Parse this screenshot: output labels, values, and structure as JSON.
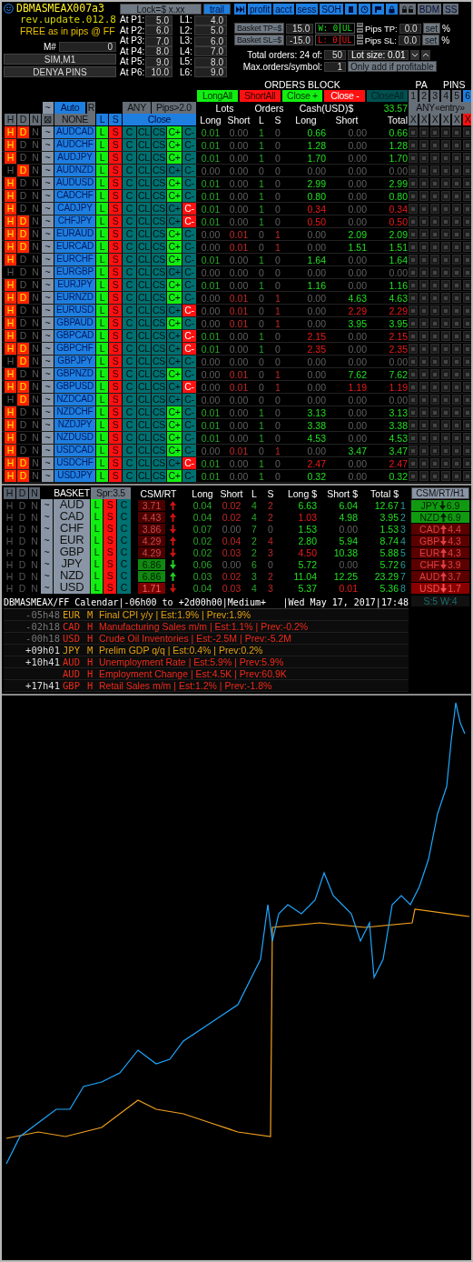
{
  "header": {
    "title": "DBMASMEAX007a3",
    "revision": "rev.update.012.8",
    "tagline": "FREE as in pips @ FF",
    "magic_label": "M#",
    "magic_value": "0",
    "buttons": [
      "SIM,M1",
      "DENYA PINS"
    ]
  },
  "lock": {
    "label": "Lock=$ x.xx",
    "trail": {
      "label": "trail",
      "on": true
    }
  },
  "levels": [
    {
      "p_label": "At P1:",
      "p_value": "5.0",
      "l_label": "L1:",
      "l_value": "4.0"
    },
    {
      "p_label": "At P2:",
      "p_value": "6.0",
      "l_label": "L2:",
      "l_value": "5.0"
    },
    {
      "p_label": "At P3:",
      "p_value": "7.0",
      "l_label": "L3:",
      "l_value": "6.0"
    },
    {
      "p_label": "At P4:",
      "p_value": "8.0",
      "l_label": "L4:",
      "l_value": "7.0"
    },
    {
      "p_label": "At P5:",
      "p_value": "9.0",
      "l_label": "L5:",
      "l_value": "8.0"
    },
    {
      "p_label": "At P6:",
      "p_value": "10.0",
      "l_label": "L6:",
      "l_value": "9.0"
    }
  ],
  "toolbar": [
    {
      "kind": "skip",
      "on": true
    },
    {
      "kind": "text",
      "label": "profit",
      "on": true
    },
    {
      "kind": "text",
      "label": "acct",
      "on": true
    },
    {
      "kind": "text",
      "label": "sess",
      "on": true
    },
    {
      "kind": "text",
      "label": "SOH",
      "on": true
    },
    {
      "kind": "clipboard",
      "on": true
    },
    {
      "kind": "clock",
      "on": true
    },
    {
      "kind": "flag",
      "on": true
    },
    {
      "kind": "lock",
      "on": true
    },
    {
      "kind": "locks",
      "on": false
    },
    {
      "kind": "text",
      "label": "BDM",
      "on": false
    },
    {
      "kind": "text",
      "label": "SS",
      "on": false
    }
  ],
  "basket_limits": [
    {
      "label": "Basket TP=$",
      "value": "15.0",
      "counter": "W: 0",
      "unit": "UL",
      "kind": "win",
      "pips_label": "Pips TP:",
      "pips_value": "0.0",
      "set": "set",
      "percent": "%"
    },
    {
      "label": "Basket SL=$",
      "value": "-15.0",
      "counter": "L: 0",
      "unit": "UL",
      "kind": "loss",
      "pips_label": "Pips SL:",
      "pips_value": "0.0",
      "set": "set",
      "percent": "%"
    }
  ],
  "orders_settings": {
    "total_label": "Total orders: 24 of:",
    "total_value": "50",
    "lot_size": "Lot size: 0.01",
    "max_label": "Max.orders/symbol:",
    "max_value": "1",
    "add_button": "Only add if profitable"
  },
  "orders_block": {
    "title": "ORDERS BLOCK",
    "pa": "PA",
    "pins_label": "PINS",
    "actions": [
      {
        "label": "LongAll",
        "kind": "buy"
      },
      {
        "label": "ShortAll",
        "kind": "sell"
      },
      {
        "label": "Close +",
        "kind": "buy"
      },
      {
        "label": "Close -",
        "kind": "sell"
      },
      {
        "label": "CloseAll",
        "kind": "all"
      }
    ],
    "pins": [
      {
        "label": "1",
        "selected": false
      },
      {
        "label": "2",
        "selected": false
      },
      {
        "label": "3",
        "selected": false
      },
      {
        "label": "4",
        "selected": false
      },
      {
        "label": "5",
        "selected": false
      },
      {
        "label": "6",
        "selected": true
      }
    ],
    "mode": "~",
    "auto": "Auto",
    "reset": "R",
    "any": "ANY",
    "pips_filter": "Pips>2.0",
    "lots": "Lots",
    "orders": "Orders",
    "cash": "Cash(USD)$",
    "cash_total": "33.57",
    "entry": "ANY«entry»",
    "filters": [
      "H",
      "D",
      "N",
      "⊠"
    ],
    "none": "NONE",
    "long": "L",
    "short": "S",
    "close": "Close",
    "columns": [
      "Long",
      "Short",
      "L",
      "S",
      "Long",
      "Short",
      "Total"
    ],
    "clear": [
      "X",
      "X",
      "X",
      "X",
      "X",
      "X"
    ]
  },
  "rows": [
    {
      "flags": [
        {
          "label": "H",
          "on": true
        },
        {
          "label": "D",
          "on": true
        },
        {
          "label": "N",
          "on": false
        }
      ],
      "mode": "~",
      "pair": "AUDCAD",
      "actions": [
        "L",
        "S",
        "C",
        "CL",
        "CS"
      ],
      "close_plus": {
        "label": "C+",
        "on": true
      },
      "close_minus": {
        "label": "C-",
        "on": false
      },
      "long_open": true,
      "short_open": false,
      "lots_long": "0.01",
      "lots_short": "0.00",
      "orders_long": "1",
      "orders_short": "0",
      "cash_long": "0.66",
      "cash_short": "0.00",
      "total": "0.66"
    },
    {
      "flags": [
        {
          "label": "H",
          "on": true
        },
        {
          "label": "D",
          "on": false
        },
        {
          "label": "N",
          "on": false
        }
      ],
      "mode": "~",
      "pair": "AUDCHF",
      "actions": [
        "L",
        "S",
        "C",
        "CL",
        "CS"
      ],
      "close_plus": {
        "label": "C+",
        "on": true
      },
      "close_minus": {
        "label": "C-",
        "on": false
      },
      "long_open": true,
      "short_open": false,
      "lots_long": "0.01",
      "lots_short": "0.00",
      "orders_long": "1",
      "orders_short": "0",
      "cash_long": "1.28",
      "cash_short": "0.00",
      "total": "1.28"
    },
    {
      "flags": [
        {
          "label": "H",
          "on": true
        },
        {
          "label": "D",
          "on": false
        },
        {
          "label": "N",
          "on": false
        }
      ],
      "mode": "~",
      "pair": "AUDJPY",
      "actions": [
        "L",
        "S",
        "C",
        "CL",
        "CS"
      ],
      "close_plus": {
        "label": "C+",
        "on": true
      },
      "close_minus": {
        "label": "C-",
        "on": false
      },
      "long_open": true,
      "short_open": false,
      "lots_long": "0.01",
      "lots_short": "0.00",
      "orders_long": "1",
      "orders_short": "0",
      "cash_long": "1.70",
      "cash_short": "0.00",
      "total": "1.70"
    },
    {
      "flags": [
        {
          "label": "H",
          "on": false
        },
        {
          "label": "D",
          "on": true
        },
        {
          "label": "N",
          "on": false
        }
      ],
      "mode": "~",
      "pair": "AUDNZD",
      "actions": [
        "L",
        "S",
        "C",
        "CL",
        "CS"
      ],
      "close_plus": {
        "label": "C+",
        "on": false
      },
      "close_minus": {
        "label": "C-",
        "on": false
      },
      "long_open": false,
      "short_open": false,
      "lots_long": "0.00",
      "lots_short": "0.00",
      "orders_long": "0",
      "orders_short": "0",
      "cash_long": "0.00",
      "cash_short": "0.00",
      "total": "0.00"
    },
    {
      "flags": [
        {
          "label": "H",
          "on": true
        },
        {
          "label": "D",
          "on": false
        },
        {
          "label": "N",
          "on": false
        }
      ],
      "mode": "~",
      "pair": "AUDUSD",
      "actions": [
        "L",
        "S",
        "C",
        "CL",
        "CS"
      ],
      "close_plus": {
        "label": "C+",
        "on": true
      },
      "close_minus": {
        "label": "C-",
        "on": false
      },
      "long_open": true,
      "short_open": false,
      "lots_long": "0.01",
      "lots_short": "0.00",
      "orders_long": "1",
      "orders_short": "0",
      "cash_long": "2.99",
      "cash_short": "0.00",
      "total": "2.99"
    },
    {
      "flags": [
        {
          "label": "H",
          "on": true
        },
        {
          "label": "D",
          "on": false
        },
        {
          "label": "N",
          "on": false
        }
      ],
      "mode": "~",
      "pair": "CADCHF",
      "actions": [
        "L",
        "S",
        "C",
        "CL",
        "CS"
      ],
      "close_plus": {
        "label": "C+",
        "on": true
      },
      "close_minus": {
        "label": "C-",
        "on": false
      },
      "long_open": true,
      "short_open": false,
      "lots_long": "0.01",
      "lots_short": "0.00",
      "orders_long": "1",
      "orders_short": "0",
      "cash_long": "0.80",
      "cash_short": "0.00",
      "total": "0.80"
    },
    {
      "flags": [
        {
          "label": "H",
          "on": true
        },
        {
          "label": "D",
          "on": false
        },
        {
          "label": "N",
          "on": false
        }
      ],
      "mode": "~",
      "pair": "CADJPY",
      "actions": [
        "L",
        "S",
        "C",
        "CL",
        "CS"
      ],
      "close_plus": {
        "label": "C+",
        "on": false
      },
      "close_minus": {
        "label": "C-",
        "on": true
      },
      "long_open": true,
      "short_open": false,
      "lots_long": "0.01",
      "lots_short": "0.00",
      "orders_long": "1",
      "orders_short": "0",
      "cash_long": "0.34",
      "cash_short": "0.00",
      "total": "0.34"
    },
    {
      "flags": [
        {
          "label": "H",
          "on": true
        },
        {
          "label": "D",
          "on": true
        },
        {
          "label": "N",
          "on": false
        }
      ],
      "mode": "~",
      "pair": "CHFJPY",
      "actions": [
        "L",
        "S",
        "C",
        "CL",
        "CS"
      ],
      "close_plus": {
        "label": "C+",
        "on": false
      },
      "close_minus": {
        "label": "C-",
        "on": true
      },
      "long_open": true,
      "short_open": false,
      "lots_long": "0.01",
      "lots_short": "0.00",
      "orders_long": "1",
      "orders_short": "0",
      "cash_long": "0.50",
      "cash_short": "0.00",
      "total": "0.50"
    },
    {
      "flags": [
        {
          "label": "H",
          "on": true
        },
        {
          "label": "D",
          "on": true
        },
        {
          "label": "N",
          "on": false
        }
      ],
      "mode": "~",
      "pair": "EURAUD",
      "actions": [
        "L",
        "S",
        "C",
        "CL",
        "CS"
      ],
      "close_plus": {
        "label": "C+",
        "on": true
      },
      "close_minus": {
        "label": "C-",
        "on": false
      },
      "long_open": false,
      "short_open": true,
      "lots_long": "0.00",
      "lots_short": "0.01",
      "orders_long": "0",
      "orders_short": "1",
      "cash_long": "0.00",
      "cash_short": "2.09",
      "total": "2.09"
    },
    {
      "flags": [
        {
          "label": "H",
          "on": true
        },
        {
          "label": "D",
          "on": true
        },
        {
          "label": "N",
          "on": false
        }
      ],
      "mode": "~",
      "pair": "EURCAD",
      "actions": [
        "L",
        "S",
        "C",
        "CL",
        "CS"
      ],
      "close_plus": {
        "label": "C+",
        "on": true
      },
      "close_minus": {
        "label": "C-",
        "on": false
      },
      "long_open": false,
      "short_open": true,
      "lots_long": "0.00",
      "lots_short": "0.01",
      "orders_long": "0",
      "orders_short": "1",
      "cash_long": "0.00",
      "cash_short": "1.51",
      "total": "1.51"
    },
    {
      "flags": [
        {
          "label": "H",
          "on": true
        },
        {
          "label": "D",
          "on": false
        },
        {
          "label": "N",
          "on": false
        }
      ],
      "mode": "~",
      "pair": "EURCHF",
      "actions": [
        "L",
        "S",
        "C",
        "CL",
        "CS"
      ],
      "close_plus": {
        "label": "C+",
        "on": true
      },
      "close_minus": {
        "label": "C-",
        "on": false
      },
      "long_open": true,
      "short_open": false,
      "lots_long": "0.01",
      "lots_short": "0.00",
      "orders_long": "1",
      "orders_short": "0",
      "cash_long": "1.64",
      "cash_short": "0.00",
      "total": "1.64"
    },
    {
      "flags": [
        {
          "label": "H",
          "on": false
        },
        {
          "label": "D",
          "on": false
        },
        {
          "label": "N",
          "on": false
        }
      ],
      "mode": "~",
      "pair": "EURGBP",
      "actions": [
        "L",
        "S",
        "C",
        "CL",
        "CS"
      ],
      "close_plus": {
        "label": "C+",
        "on": false
      },
      "close_minus": {
        "label": "C-",
        "on": false
      },
      "long_open": false,
      "short_open": false,
      "lots_long": "0.00",
      "lots_short": "0.00",
      "orders_long": "0",
      "orders_short": "0",
      "cash_long": "0.00",
      "cash_short": "0.00",
      "total": "0.00"
    },
    {
      "flags": [
        {
          "label": "H",
          "on": true
        },
        {
          "label": "D",
          "on": false
        },
        {
          "label": "N",
          "on": false
        }
      ],
      "mode": "~",
      "pair": "EURJPY",
      "actions": [
        "L",
        "S",
        "C",
        "CL",
        "CS"
      ],
      "close_plus": {
        "label": "C+",
        "on": true
      },
      "close_minus": {
        "label": "C-",
        "on": false
      },
      "long_open": true,
      "short_open": false,
      "lots_long": "0.01",
      "lots_short": "0.00",
      "orders_long": "1",
      "orders_short": "0",
      "cash_long": "1.16",
      "cash_short": "0.00",
      "total": "1.16"
    },
    {
      "flags": [
        {
          "label": "H",
          "on": true
        },
        {
          "label": "D",
          "on": true
        },
        {
          "label": "N",
          "on": false
        }
      ],
      "mode": "~",
      "pair": "EURNZD",
      "actions": [
        "L",
        "S",
        "C",
        "CL",
        "CS"
      ],
      "close_plus": {
        "label": "C+",
        "on": true
      },
      "close_minus": {
        "label": "C-",
        "on": false
      },
      "long_open": false,
      "short_open": true,
      "lots_long": "0.00",
      "lots_short": "0.01",
      "orders_long": "0",
      "orders_short": "1",
      "cash_long": "0.00",
      "cash_short": "4.63",
      "total": "4.63"
    },
    {
      "flags": [
        {
          "label": "H",
          "on": true
        },
        {
          "label": "D",
          "on": false
        },
        {
          "label": "N",
          "on": false
        }
      ],
      "mode": "~",
      "pair": "EURUSD",
      "actions": [
        "L",
        "S",
        "C",
        "CL",
        "CS"
      ],
      "close_plus": {
        "label": "C+",
        "on": false
      },
      "close_minus": {
        "label": "C-",
        "on": true
      },
      "long_open": false,
      "short_open": true,
      "lots_long": "0.00",
      "lots_short": "0.01",
      "orders_long": "0",
      "orders_short": "1",
      "cash_long": "0.00",
      "cash_short": "2.29",
      "total": "2.29"
    },
    {
      "flags": [
        {
          "label": "H",
          "on": true
        },
        {
          "label": "D",
          "on": false
        },
        {
          "label": "N",
          "on": false
        }
      ],
      "mode": "~",
      "pair": "GBPAUD",
      "actions": [
        "L",
        "S",
        "C",
        "CL",
        "CS"
      ],
      "close_plus": {
        "label": "C+",
        "on": true
      },
      "close_minus": {
        "label": "C-",
        "on": false
      },
      "long_open": false,
      "short_open": true,
      "lots_long": "0.00",
      "lots_short": "0.01",
      "orders_long": "0",
      "orders_short": "1",
      "cash_long": "0.00",
      "cash_short": "3.95",
      "total": "3.95"
    },
    {
      "flags": [
        {
          "label": "H",
          "on": true
        },
        {
          "label": "D",
          "on": false
        },
        {
          "label": "N",
          "on": false
        }
      ],
      "mode": "~",
      "pair": "GBPCAD",
      "actions": [
        "L",
        "S",
        "C",
        "CL",
        "CS"
      ],
      "close_plus": {
        "label": "C+",
        "on": false
      },
      "close_minus": {
        "label": "C-",
        "on": true
      },
      "long_open": true,
      "short_open": false,
      "lots_long": "0.01",
      "lots_short": "0.00",
      "orders_long": "1",
      "orders_short": "0",
      "cash_long": "2.15",
      "cash_short": "0.00",
      "total": "2.15"
    },
    {
      "flags": [
        {
          "label": "H",
          "on": true
        },
        {
          "label": "D",
          "on": true
        },
        {
          "label": "N",
          "on": false
        }
      ],
      "mode": "~",
      "pair": "GBPCHF",
      "actions": [
        "L",
        "S",
        "C",
        "CL",
        "CS"
      ],
      "close_plus": {
        "label": "C+",
        "on": false
      },
      "close_minus": {
        "label": "C-",
        "on": true
      },
      "long_open": true,
      "short_open": false,
      "lots_long": "0.01",
      "lots_short": "0.00",
      "orders_long": "1",
      "orders_short": "0",
      "cash_long": "2.35",
      "cash_short": "0.00",
      "total": "2.35"
    },
    {
      "flags": [
        {
          "label": "H",
          "on": false
        },
        {
          "label": "D",
          "on": true
        },
        {
          "label": "N",
          "on": false
        }
      ],
      "mode": "~",
      "pair": "GBPJPY",
      "actions": [
        "L",
        "S",
        "C",
        "CL",
        "CS"
      ],
      "close_plus": {
        "label": "C+",
        "on": false
      },
      "close_minus": {
        "label": "C-",
        "on": false
      },
      "long_open": false,
      "short_open": false,
      "lots_long": "0.00",
      "lots_short": "0.00",
      "orders_long": "0",
      "orders_short": "0",
      "cash_long": "0.00",
      "cash_short": "0.00",
      "total": "0.00"
    },
    {
      "flags": [
        {
          "label": "H",
          "on": true
        },
        {
          "label": "D",
          "on": false
        },
        {
          "label": "N",
          "on": false
        }
      ],
      "mode": "~",
      "pair": "GBPNZD",
      "actions": [
        "L",
        "S",
        "C",
        "CL",
        "CS"
      ],
      "close_plus": {
        "label": "C+",
        "on": true
      },
      "close_minus": {
        "label": "C-",
        "on": false
      },
      "long_open": false,
      "short_open": true,
      "lots_long": "0.00",
      "lots_short": "0.01",
      "orders_long": "0",
      "orders_short": "1",
      "cash_long": "0.00",
      "cash_short": "7.62",
      "total": "7.62"
    },
    {
      "flags": [
        {
          "label": "H",
          "on": true
        },
        {
          "label": "D",
          "on": true
        },
        {
          "label": "N",
          "on": false
        }
      ],
      "mode": "~",
      "pair": "GBPUSD",
      "actions": [
        "L",
        "S",
        "C",
        "CL",
        "CS"
      ],
      "close_plus": {
        "label": "C+",
        "on": false
      },
      "close_minus": {
        "label": "C-",
        "on": true
      },
      "long_open": false,
      "short_open": true,
      "lots_long": "0.00",
      "lots_short": "0.01",
      "orders_long": "0",
      "orders_short": "1",
      "cash_long": "0.00",
      "cash_short": "1.19",
      "total": "1.19"
    },
    {
      "flags": [
        {
          "label": "H",
          "on": false
        },
        {
          "label": "D",
          "on": true
        },
        {
          "label": "N",
          "on": false
        }
      ],
      "mode": "~",
      "pair": "NZDCAD",
      "actions": [
        "L",
        "S",
        "C",
        "CL",
        "CS"
      ],
      "close_plus": {
        "label": "C+",
        "on": false
      },
      "close_minus": {
        "label": "C-",
        "on": false
      },
      "long_open": false,
      "short_open": false,
      "lots_long": "0.00",
      "lots_short": "0.00",
      "orders_long": "0",
      "orders_short": "0",
      "cash_long": "0.00",
      "cash_short": "0.00",
      "total": "0.00"
    },
    {
      "flags": [
        {
          "label": "H",
          "on": true
        },
        {
          "label": "D",
          "on": false
        },
        {
          "label": "N",
          "on": false
        }
      ],
      "mode": "~",
      "pair": "NZDCHF",
      "actions": [
        "L",
        "S",
        "C",
        "CL",
        "CS"
      ],
      "close_plus": {
        "label": "C+",
        "on": true
      },
      "close_minus": {
        "label": "C-",
        "on": false
      },
      "long_open": true,
      "short_open": false,
      "lots_long": "0.01",
      "lots_short": "0.00",
      "orders_long": "1",
      "orders_short": "0",
      "cash_long": "3.13",
      "cash_short": "0.00",
      "total": "3.13"
    },
    {
      "flags": [
        {
          "label": "H",
          "on": true
        },
        {
          "label": "D",
          "on": false
        },
        {
          "label": "N",
          "on": false
        }
      ],
      "mode": "~",
      "pair": "NZDJPY",
      "actions": [
        "L",
        "S",
        "C",
        "CL",
        "CS"
      ],
      "close_plus": {
        "label": "C+",
        "on": true
      },
      "close_minus": {
        "label": "C-",
        "on": false
      },
      "long_open": true,
      "short_open": false,
      "lots_long": "0.01",
      "lots_short": "0.00",
      "orders_long": "1",
      "orders_short": "0",
      "cash_long": "3.38",
      "cash_short": "0.00",
      "total": "3.38"
    },
    {
      "flags": [
        {
          "label": "H",
          "on": true
        },
        {
          "label": "D",
          "on": false
        },
        {
          "label": "N",
          "on": false
        }
      ],
      "mode": "~",
      "pair": "NZDUSD",
      "actions": [
        "L",
        "S",
        "C",
        "CL",
        "CS"
      ],
      "close_plus": {
        "label": "C+",
        "on": true
      },
      "close_minus": {
        "label": "C-",
        "on": false
      },
      "long_open": true,
      "short_open": false,
      "lots_long": "0.01",
      "lots_short": "0.00",
      "orders_long": "1",
      "orders_short": "0",
      "cash_long": "4.53",
      "cash_short": "0.00",
      "total": "4.53"
    },
    {
      "flags": [
        {
          "label": "H",
          "on": true
        },
        {
          "label": "D",
          "on": false
        },
        {
          "label": "N",
          "on": false
        }
      ],
      "mode": "~",
      "pair": "USDCAD",
      "actions": [
        "L",
        "S",
        "C",
        "CL",
        "CS"
      ],
      "close_plus": {
        "label": "C+",
        "on": true
      },
      "close_minus": {
        "label": "C-",
        "on": false
      },
      "long_open": false,
      "short_open": true,
      "lots_long": "0.00",
      "lots_short": "0.01",
      "orders_long": "0",
      "orders_short": "1",
      "cash_long": "0.00",
      "cash_short": "3.47",
      "total": "3.47"
    },
    {
      "flags": [
        {
          "label": "H",
          "on": true
        },
        {
          "label": "D",
          "on": true
        },
        {
          "label": "N",
          "on": false
        }
      ],
      "mode": "~",
      "pair": "USDCHF",
      "actions": [
        "L",
        "S",
        "C",
        "CL",
        "CS"
      ],
      "close_plus": {
        "label": "C+",
        "on": false
      },
      "close_minus": {
        "label": "C-",
        "on": true
      },
      "long_open": true,
      "short_open": false,
      "lots_long": "0.01",
      "lots_short": "0.00",
      "orders_long": "1",
      "orders_short": "0",
      "cash_long": "2.47",
      "cash_short": "0.00",
      "total": "2.47"
    },
    {
      "flags": [
        {
          "label": "H",
          "on": true
        },
        {
          "label": "D",
          "on": true
        },
        {
          "label": "N",
          "on": false
        }
      ],
      "mode": "~",
      "pair": "USDJPY",
      "actions": [
        "L",
        "S",
        "C",
        "CL",
        "CS"
      ],
      "close_plus": {
        "label": "C+",
        "on": true
      },
      "close_minus": {
        "label": "C-",
        "on": false
      },
      "long_open": true,
      "short_open": false,
      "lots_long": "0.01",
      "lots_short": "0.00",
      "orders_long": "1",
      "orders_short": "0",
      "cash_long": "0.32",
      "cash_short": "0.00",
      "total": "0.32"
    }
  ],
  "basket": {
    "filters": [
      "H",
      "D",
      "N"
    ],
    "title": "BASKET",
    "spread": "Spr:3.5",
    "csm_label": "CSM/RT",
    "columns": [
      "Long",
      "Short",
      "L",
      "S",
      "Long $",
      "Short $",
      "Total $"
    ],
    "rows": [
      {
        "flags": [
          "H",
          "D",
          "N"
        ],
        "mode": "~",
        "currency": "AUD",
        "actions": [
          "L",
          "S",
          "C"
        ],
        "csm": "3.71",
        "color": "#4a0000",
        "rising": true,
        "lots_long": "0.04",
        "lots_short": "0.02",
        "orders_long": "4",
        "orders_short": "2",
        "cash_long": "6.63",
        "long_loss": false,
        "cash_short": "6.04",
        "short_open": true,
        "short_loss": false,
        "total": "12.67",
        "rank": "1"
      },
      {
        "flags": [
          "H",
          "D",
          "N"
        ],
        "mode": "~",
        "currency": "CAD",
        "actions": [
          "L",
          "S",
          "C"
        ],
        "csm": "4.43",
        "color": "#4a0000",
        "rising": true,
        "lots_long": "0.04",
        "lots_short": "0.02",
        "orders_long": "4",
        "orders_short": "2",
        "cash_long": "1.03",
        "long_loss": true,
        "cash_short": "4.98",
        "short_open": true,
        "short_loss": false,
        "total": "3.95",
        "rank": "2"
      },
      {
        "flags": [
          "H",
          "D",
          "N"
        ],
        "mode": "~",
        "currency": "CHF",
        "actions": [
          "L",
          "S",
          "C"
        ],
        "csm": "3.86",
        "color": "#4a0000",
        "rising": false,
        "lots_long": "0.07",
        "lots_short": "0.00",
        "orders_long": "7",
        "orders_short": "0",
        "cash_long": "1.53",
        "long_loss": false,
        "cash_short": "0.00",
        "short_open": false,
        "short_loss": false,
        "total": "1.53",
        "rank": "3"
      },
      {
        "flags": [
          "H",
          "D",
          "N"
        ],
        "mode": "~",
        "currency": "EUR",
        "actions": [
          "L",
          "S",
          "C"
        ],
        "csm": "4.29",
        "color": "#4a0000",
        "rising": true,
        "lots_long": "0.02",
        "lots_short": "0.04",
        "orders_long": "2",
        "orders_short": "4",
        "cash_long": "2.80",
        "long_loss": false,
        "cash_short": "5.94",
        "short_open": true,
        "short_loss": false,
        "total": "8.74",
        "rank": "4"
      },
      {
        "flags": [
          "H",
          "D",
          "N"
        ],
        "mode": "~",
        "currency": "GBP",
        "actions": [
          "L",
          "S",
          "C"
        ],
        "csm": "4.29",
        "color": "#4a0000",
        "rising": false,
        "lots_long": "0.02",
        "lots_short": "0.03",
        "orders_long": "2",
        "orders_short": "3",
        "cash_long": "4.50",
        "long_loss": true,
        "cash_short": "10.38",
        "short_open": true,
        "short_loss": false,
        "total": "5.88",
        "rank": "5"
      },
      {
        "flags": [
          "H",
          "D",
          "N"
        ],
        "mode": "~",
        "currency": "JPY",
        "actions": [
          "L",
          "S",
          "C"
        ],
        "csm": "6.86",
        "color": "#118811",
        "rising": false,
        "lots_long": "0.06",
        "lots_short": "0.00",
        "orders_long": "6",
        "orders_short": "0",
        "cash_long": "5.72",
        "long_loss": false,
        "cash_short": "0.00",
        "short_open": false,
        "short_loss": false,
        "total": "5.72",
        "rank": "6"
      },
      {
        "flags": [
          "H",
          "D",
          "N"
        ],
        "mode": "~",
        "currency": "NZD",
        "actions": [
          "L",
          "S",
          "C"
        ],
        "csm": "6.86",
        "color": "#118811",
        "rising": true,
        "lots_long": "0.03",
        "lots_short": "0.02",
        "orders_long": "3",
        "orders_short": "2",
        "cash_long": "11.04",
        "long_loss": false,
        "cash_short": "12.25",
        "short_open": true,
        "short_loss": false,
        "total": "23.29",
        "rank": "7"
      },
      {
        "flags": [
          "H",
          "D",
          "N"
        ],
        "mode": "~",
        "currency": "USD",
        "actions": [
          "L",
          "S",
          "C"
        ],
        "csm": "1.71",
        "color": "#7a0000",
        "rising": false,
        "lots_long": "0.04",
        "lots_short": "0.03",
        "orders_long": "4",
        "orders_short": "3",
        "cash_long": "5.37",
        "long_loss": false,
        "cash_short": "0.01",
        "short_open": true,
        "short_loss": true,
        "total": "5.36",
        "rank": "8"
      }
    ]
  },
  "strength": {
    "title": "CSM/RT/H1",
    "items": [
      {
        "currency": "JPY",
        "rising": false,
        "value": "6.9",
        "color": "#119911"
      },
      {
        "currency": "NZD",
        "rising": true,
        "value": "6.9",
        "color": "#119911"
      },
      {
        "currency": "CAD",
        "rising": true,
        "value": "4.4",
        "color": "#5a0000"
      },
      {
        "currency": "GBP",
        "rising": false,
        "value": "4.3",
        "color": "#5a0000"
      },
      {
        "currency": "EUR",
        "rising": true,
        "value": "4.3",
        "color": "#5a0000"
      },
      {
        "currency": "CHF",
        "rising": false,
        "value": "3.9",
        "color": "#5a0000"
      },
      {
        "currency": "AUD",
        "rising": true,
        "value": "3.7",
        "color": "#5a0000"
      },
      {
        "currency": "USD",
        "rising": false,
        "value": "1.7",
        "color": "#8a0000"
      }
    ],
    "summary": "S:5 W:4"
  },
  "calendar": {
    "title": "DBMASMEAX/FF Calendar|-06h00 to +2d00h00|Medium+",
    "date": "|Wed May 17, 2017|17:48",
    "events": [
      {
        "time": "-05h48",
        "past": true,
        "currency": "EUR",
        "impact": "M",
        "text": "Final CPI y/y | Est:1.9% | Prev:1.9%"
      },
      {
        "time": "-02h18",
        "past": true,
        "currency": "CAD",
        "impact": "H",
        "text": "Manufacturing Sales m/m | Est:1.1% | Prev:-0.2%"
      },
      {
        "time": "-00h18",
        "past": true,
        "currency": "USD",
        "impact": "H",
        "text": "Crude Oil Inventories | Est:-2.5M | Prev:-5.2M"
      },
      {
        "time": "+09h01",
        "past": false,
        "currency": "JPY",
        "impact": "M",
        "text": "Prelim GDP q/q | Est:0.4% | Prev:0.2%"
      },
      {
        "time": "+10h41",
        "past": false,
        "currency": "AUD",
        "impact": "H",
        "text": "Unemployment Rate | Est:5.9% | Prev:5.9%"
      },
      {
        "currency": "AUD",
        "impact": "H",
        "text": "Employment Change | Est:4.5K | Prev:60.9K"
      },
      {
        "time": "+17h41",
        "past": false,
        "currency": "GBP",
        "impact": "H",
        "text": "Retail Sales m/m | Est:1.2% | Prev:-1.8%"
      }
    ]
  }
}
